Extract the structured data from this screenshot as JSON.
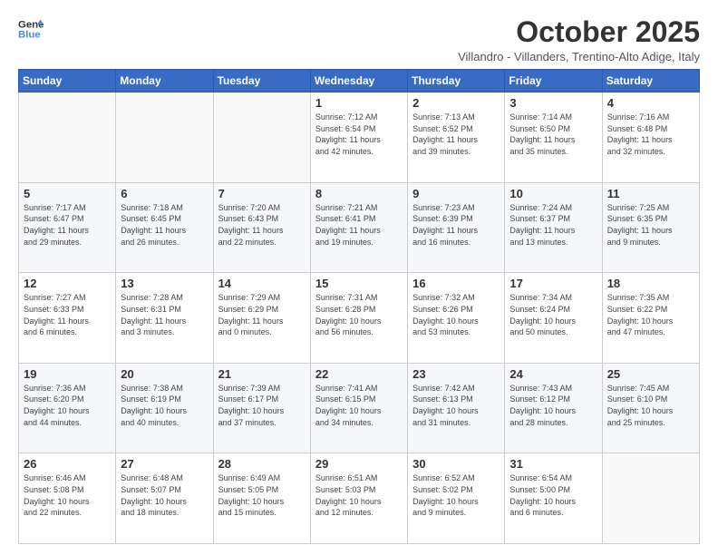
{
  "header": {
    "logo_line1": "General",
    "logo_line2": "Blue",
    "title": "October 2025",
    "subtitle": "Villandro - Villanders, Trentino-Alto Adige, Italy"
  },
  "days_of_week": [
    "Sunday",
    "Monday",
    "Tuesday",
    "Wednesday",
    "Thursday",
    "Friday",
    "Saturday"
  ],
  "weeks": [
    [
      {
        "day": "",
        "info": ""
      },
      {
        "day": "",
        "info": ""
      },
      {
        "day": "",
        "info": ""
      },
      {
        "day": "1",
        "info": "Sunrise: 7:12 AM\nSunset: 6:54 PM\nDaylight: 11 hours\nand 42 minutes."
      },
      {
        "day": "2",
        "info": "Sunrise: 7:13 AM\nSunset: 6:52 PM\nDaylight: 11 hours\nand 39 minutes."
      },
      {
        "day": "3",
        "info": "Sunrise: 7:14 AM\nSunset: 6:50 PM\nDaylight: 11 hours\nand 35 minutes."
      },
      {
        "day": "4",
        "info": "Sunrise: 7:16 AM\nSunset: 6:48 PM\nDaylight: 11 hours\nand 32 minutes."
      }
    ],
    [
      {
        "day": "5",
        "info": "Sunrise: 7:17 AM\nSunset: 6:47 PM\nDaylight: 11 hours\nand 29 minutes."
      },
      {
        "day": "6",
        "info": "Sunrise: 7:18 AM\nSunset: 6:45 PM\nDaylight: 11 hours\nand 26 minutes."
      },
      {
        "day": "7",
        "info": "Sunrise: 7:20 AM\nSunset: 6:43 PM\nDaylight: 11 hours\nand 22 minutes."
      },
      {
        "day": "8",
        "info": "Sunrise: 7:21 AM\nSunset: 6:41 PM\nDaylight: 11 hours\nand 19 minutes."
      },
      {
        "day": "9",
        "info": "Sunrise: 7:23 AM\nSunset: 6:39 PM\nDaylight: 11 hours\nand 16 minutes."
      },
      {
        "day": "10",
        "info": "Sunrise: 7:24 AM\nSunset: 6:37 PM\nDaylight: 11 hours\nand 13 minutes."
      },
      {
        "day": "11",
        "info": "Sunrise: 7:25 AM\nSunset: 6:35 PM\nDaylight: 11 hours\nand 9 minutes."
      }
    ],
    [
      {
        "day": "12",
        "info": "Sunrise: 7:27 AM\nSunset: 6:33 PM\nDaylight: 11 hours\nand 6 minutes."
      },
      {
        "day": "13",
        "info": "Sunrise: 7:28 AM\nSunset: 6:31 PM\nDaylight: 11 hours\nand 3 minutes."
      },
      {
        "day": "14",
        "info": "Sunrise: 7:29 AM\nSunset: 6:29 PM\nDaylight: 11 hours\nand 0 minutes."
      },
      {
        "day": "15",
        "info": "Sunrise: 7:31 AM\nSunset: 6:28 PM\nDaylight: 10 hours\nand 56 minutes."
      },
      {
        "day": "16",
        "info": "Sunrise: 7:32 AM\nSunset: 6:26 PM\nDaylight: 10 hours\nand 53 minutes."
      },
      {
        "day": "17",
        "info": "Sunrise: 7:34 AM\nSunset: 6:24 PM\nDaylight: 10 hours\nand 50 minutes."
      },
      {
        "day": "18",
        "info": "Sunrise: 7:35 AM\nSunset: 6:22 PM\nDaylight: 10 hours\nand 47 minutes."
      }
    ],
    [
      {
        "day": "19",
        "info": "Sunrise: 7:36 AM\nSunset: 6:20 PM\nDaylight: 10 hours\nand 44 minutes."
      },
      {
        "day": "20",
        "info": "Sunrise: 7:38 AM\nSunset: 6:19 PM\nDaylight: 10 hours\nand 40 minutes."
      },
      {
        "day": "21",
        "info": "Sunrise: 7:39 AM\nSunset: 6:17 PM\nDaylight: 10 hours\nand 37 minutes."
      },
      {
        "day": "22",
        "info": "Sunrise: 7:41 AM\nSunset: 6:15 PM\nDaylight: 10 hours\nand 34 minutes."
      },
      {
        "day": "23",
        "info": "Sunrise: 7:42 AM\nSunset: 6:13 PM\nDaylight: 10 hours\nand 31 minutes."
      },
      {
        "day": "24",
        "info": "Sunrise: 7:43 AM\nSunset: 6:12 PM\nDaylight: 10 hours\nand 28 minutes."
      },
      {
        "day": "25",
        "info": "Sunrise: 7:45 AM\nSunset: 6:10 PM\nDaylight: 10 hours\nand 25 minutes."
      }
    ],
    [
      {
        "day": "26",
        "info": "Sunrise: 6:46 AM\nSunset: 5:08 PM\nDaylight: 10 hours\nand 22 minutes."
      },
      {
        "day": "27",
        "info": "Sunrise: 6:48 AM\nSunset: 5:07 PM\nDaylight: 10 hours\nand 18 minutes."
      },
      {
        "day": "28",
        "info": "Sunrise: 6:49 AM\nSunset: 5:05 PM\nDaylight: 10 hours\nand 15 minutes."
      },
      {
        "day": "29",
        "info": "Sunrise: 6:51 AM\nSunset: 5:03 PM\nDaylight: 10 hours\nand 12 minutes."
      },
      {
        "day": "30",
        "info": "Sunrise: 6:52 AM\nSunset: 5:02 PM\nDaylight: 10 hours\nand 9 minutes."
      },
      {
        "day": "31",
        "info": "Sunrise: 6:54 AM\nSunset: 5:00 PM\nDaylight: 10 hours\nand 6 minutes."
      },
      {
        "day": "",
        "info": ""
      }
    ]
  ]
}
